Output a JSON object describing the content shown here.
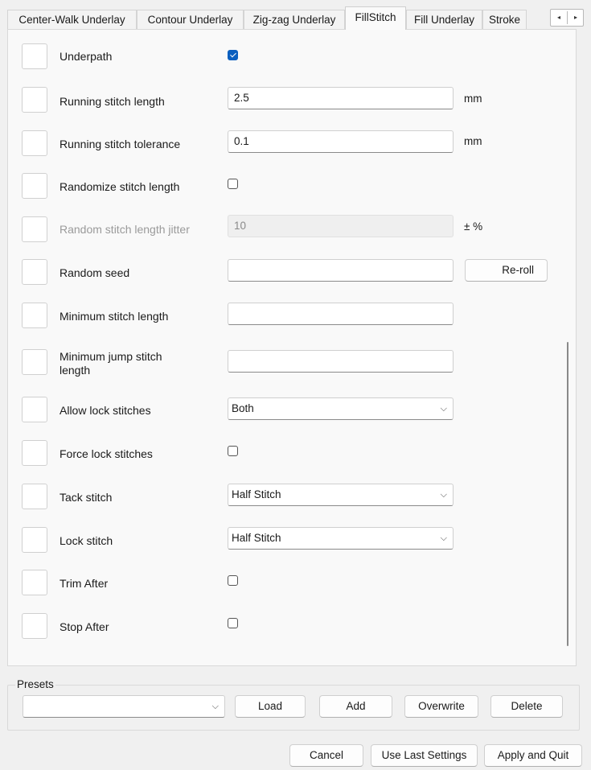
{
  "tabs": [
    {
      "label": "Center-Walk Underlay",
      "active": false
    },
    {
      "label": "Contour Underlay",
      "active": false
    },
    {
      "label": "Zig-zag Underlay",
      "active": false
    },
    {
      "label": "FillStitch",
      "active": true
    },
    {
      "label": "Fill Underlay",
      "active": false
    },
    {
      "label": "Stroke",
      "active": false
    }
  ],
  "tab_scroll": {
    "left": "◂",
    "right": "▸"
  },
  "params": {
    "underpath": {
      "label": "Underpath",
      "checked": true
    },
    "running_stitch_length": {
      "label": "Running stitch length",
      "value": "2.5",
      "unit": "mm"
    },
    "running_stitch_tolerance": {
      "label": "Running stitch tolerance",
      "value": "0.1",
      "unit": "mm"
    },
    "randomize_stitch_length": {
      "label": "Randomize stitch length",
      "checked": false
    },
    "random_stitch_length_jitter": {
      "label": "Random stitch length jitter",
      "value": "10",
      "unit": "± %",
      "disabled": true
    },
    "random_seed": {
      "label": "Random seed",
      "value": "",
      "button": "Re-roll"
    },
    "minimum_stitch_length": {
      "label": "Minimum stitch length",
      "value": ""
    },
    "minimum_jump_stitch_length": {
      "label_line1": "Minimum jump stitch",
      "label_line2": "length",
      "value": ""
    },
    "allow_lock_stitches": {
      "label": "Allow lock stitches",
      "value": "Both"
    },
    "force_lock_stitches": {
      "label": "Force lock stitches",
      "checked": false
    },
    "tack_stitch": {
      "label": "Tack stitch",
      "value": "Half Stitch"
    },
    "lock_stitch": {
      "label": "Lock stitch",
      "value": "Half Stitch"
    },
    "trim_after": {
      "label": "Trim After",
      "checked": false
    },
    "stop_after": {
      "label": "Stop After",
      "checked": false
    }
  },
  "presets": {
    "title": "Presets",
    "selected": "",
    "load": "Load",
    "add": "Add",
    "overwrite": "Overwrite",
    "delete": "Delete"
  },
  "footer": {
    "cancel": "Cancel",
    "use_last": "Use Last Settings",
    "apply_quit": "Apply and Quit"
  },
  "icons": {
    "chevron": "⌵",
    "combo_chevron": "chevron-down-icon"
  },
  "colors": {
    "accent": "#0a5fbf",
    "panel": "#f9f9f9",
    "window": "#f0f0f0"
  }
}
